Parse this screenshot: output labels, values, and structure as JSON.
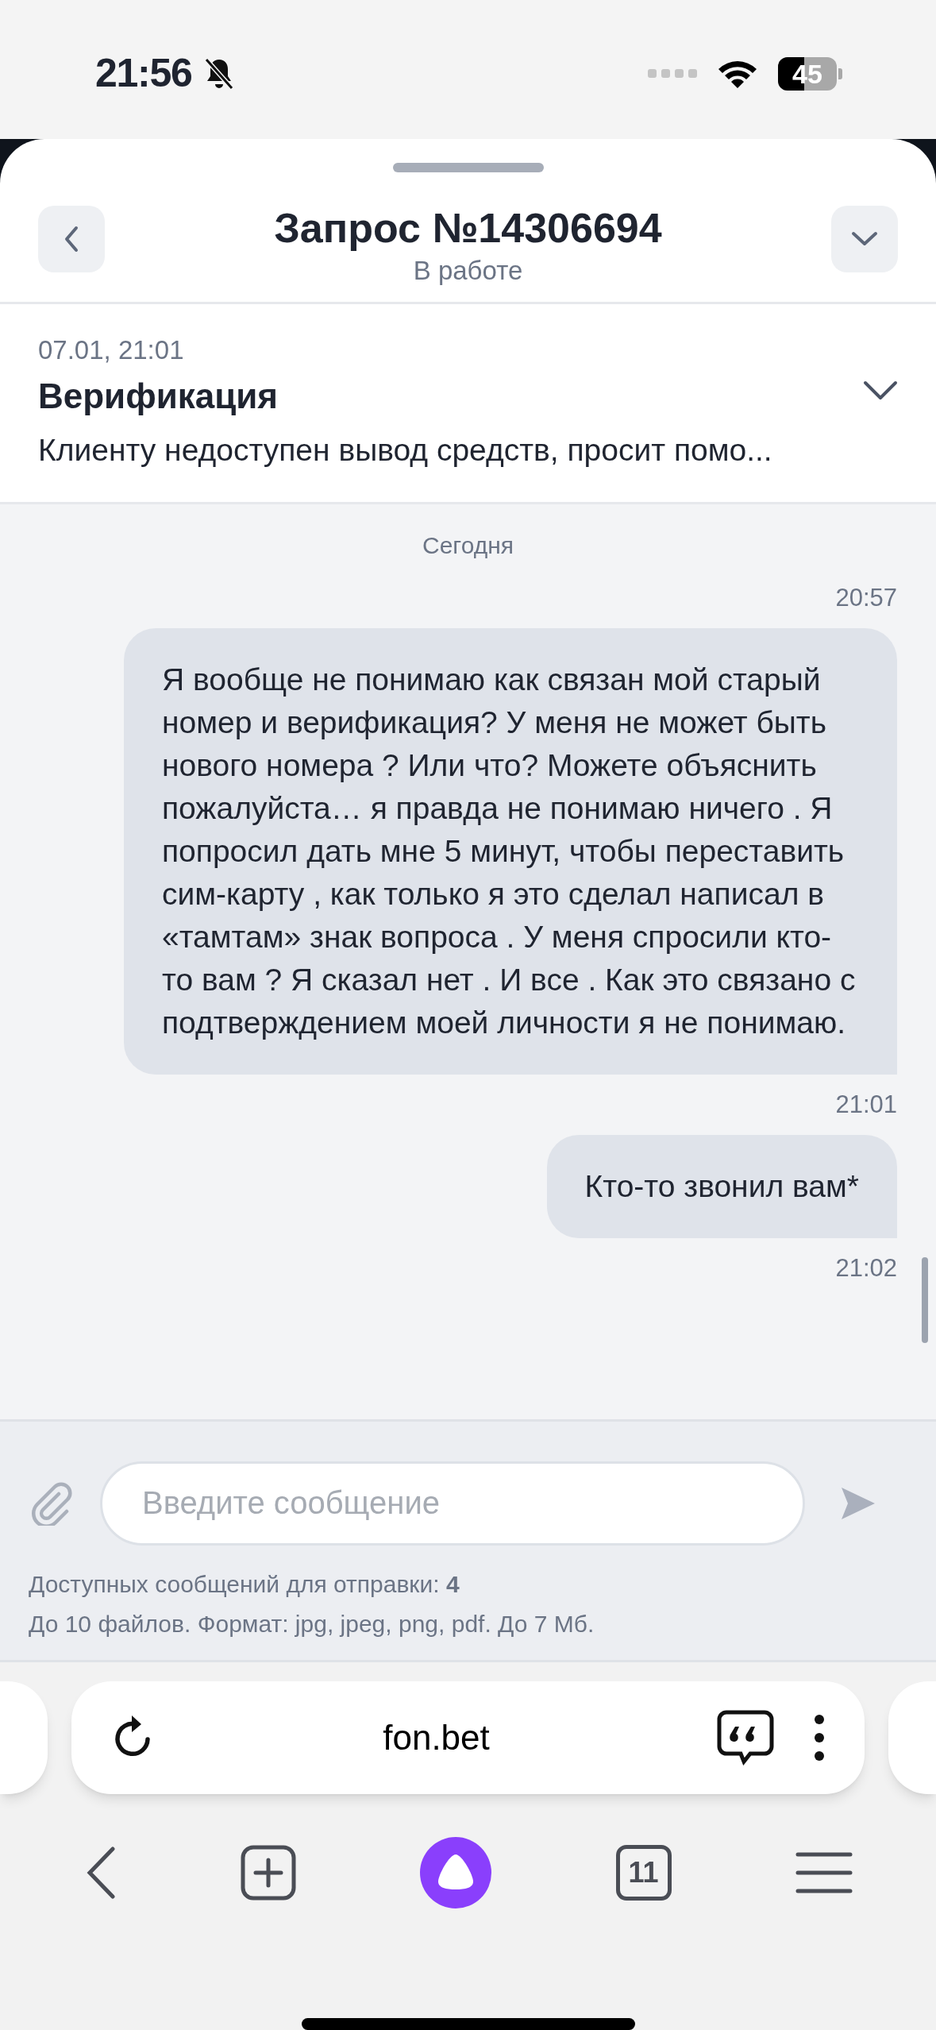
{
  "status_bar": {
    "time": "21:56",
    "battery": "45"
  },
  "header": {
    "title": "Запрос №14306694",
    "subtitle": "В работе"
  },
  "request": {
    "date": "07.01, 21:01",
    "title": "Верификация",
    "description": "Клиенту недоступен вывод средств, просит помо..."
  },
  "chat": {
    "items": [
      {
        "kind": "date",
        "text": "Сегодня"
      },
      {
        "kind": "time",
        "text": "20:57"
      },
      {
        "kind": "message",
        "text": "Я вообще не понимаю как связан мой старый номер и верификация? У меня не может быть нового номера ? Или что? Можете объяснить пожалуйста… я правда не понимаю ничего . Я попросил дать мне 5 минут, чтобы переставить сим-карту , как только я это сделал написал в «тамтам» знак вопроса . У меня спросили кто-то вам ? Я сказал нет . И все . Как это связано с подтверждением моей личности я не понимаю."
      },
      {
        "kind": "time",
        "text": "21:01"
      },
      {
        "kind": "message",
        "text": "Кто-то звонил вам*"
      },
      {
        "kind": "time",
        "text": "21:02"
      }
    ]
  },
  "composer": {
    "placeholder": "Введите сообщение",
    "quota": "Доступных сообщений для отправки: **4**",
    "files_note": "До 10 файлов. Формат: jpg, jpeg, png, pdf. До 7 Мб."
  },
  "browser": {
    "url": "fon.bet",
    "tabs_count": "11"
  }
}
